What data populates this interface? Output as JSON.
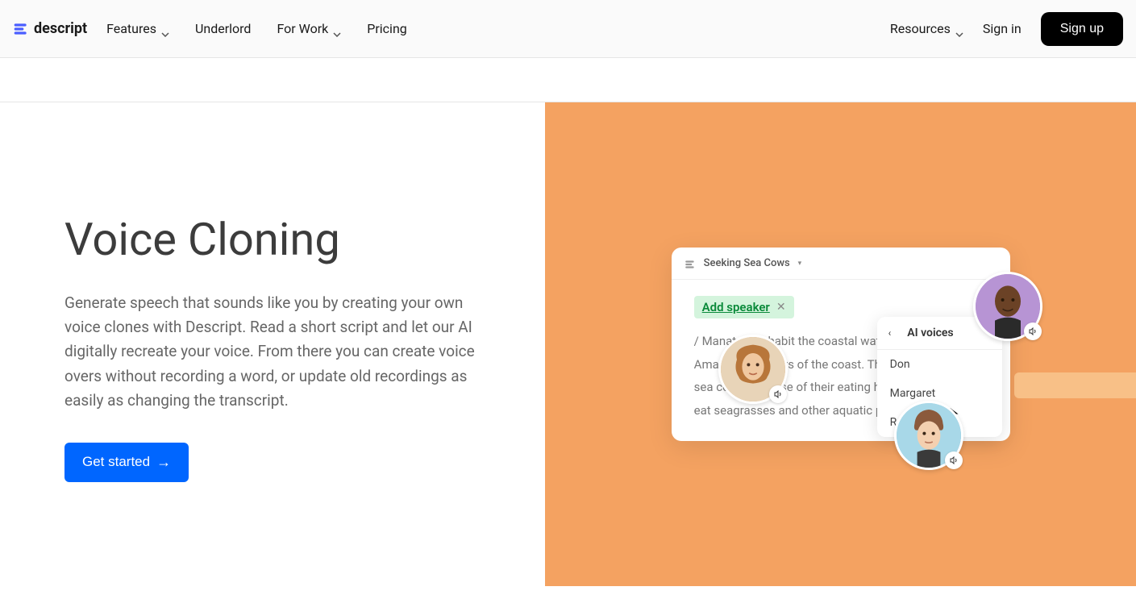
{
  "header": {
    "logo_text": "descript",
    "nav": {
      "features": "Features",
      "underlord": "Underlord",
      "for_work": "For Work",
      "pricing": "Pricing",
      "resources": "Resources"
    },
    "signin": "Sign in",
    "signup": "Sign up"
  },
  "hero": {
    "title": "Voice Cloning",
    "description": "Generate speech that sounds like you by creating your own voice clones with Descript. Read a short script and let our AI digitally recreate your voice. From there you can create voice overs without recording a word, or update old recordings as easily as changing the transcript.",
    "cta_label": "Get started"
  },
  "app_preview": {
    "doc_title": "Seeking Sea Cows",
    "add_speaker_label": "Add speaker",
    "transcript_lines": "/ Manatees inhabit the coastal waters, estuaries of the Amazon and rivers of the coast. They're nicknamed sea cows because of their eating habits. / They mainly eat seagrasses and other aquatic plants.",
    "voices_panel": {
      "title": "AI voices",
      "items": [
        "Don",
        "Margaret",
        "Roger"
      ]
    }
  }
}
